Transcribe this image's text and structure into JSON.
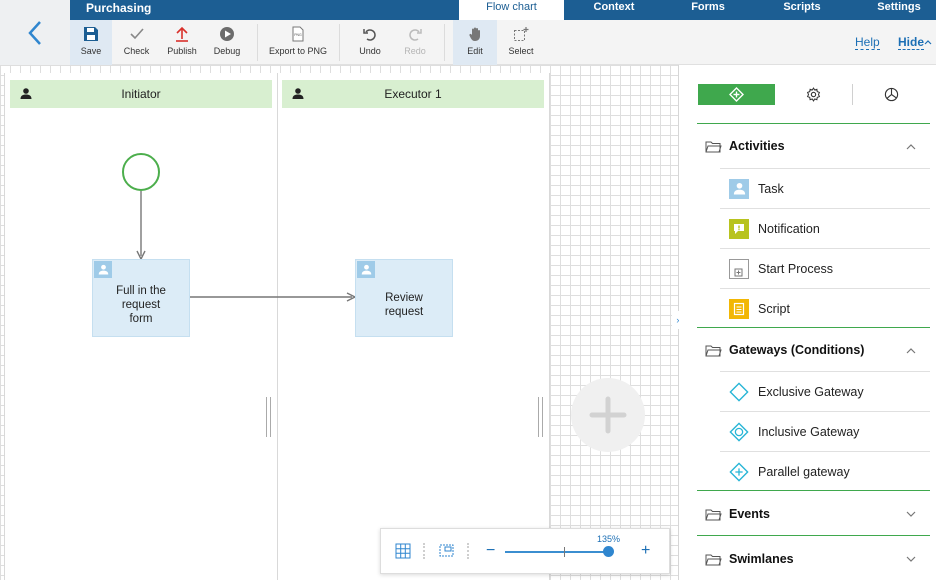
{
  "app": {
    "title": "Purchasing",
    "back_icon": "chevron-left-icon"
  },
  "nav_tabs": [
    {
      "label": "Flow chart",
      "active": true
    },
    {
      "label": "Context",
      "active": false
    },
    {
      "label": "Forms",
      "active": false
    },
    {
      "label": "Scripts",
      "active": false
    },
    {
      "label": "Settings",
      "active": false
    }
  ],
  "toolbar": {
    "save": "Save",
    "check": "Check",
    "publish": "Publish",
    "debug": "Debug",
    "export": "Export to PNG",
    "undo": "Undo",
    "redo": "Redo",
    "edit": "Edit",
    "select": "Select",
    "help": "Help",
    "hide": "Hide"
  },
  "lanes": [
    {
      "name": "Initiator"
    },
    {
      "name": "Executor 1"
    }
  ],
  "tasks": {
    "fill_form": [
      "Full in the",
      "request",
      "form"
    ],
    "review": [
      "Review",
      "request"
    ]
  },
  "zoom": {
    "percent_label": "135%",
    "value": 135
  },
  "panel": {
    "tabs": [
      {
        "icon": "diamond-icon",
        "active": true
      },
      {
        "icon": "gear-icon",
        "active": false
      },
      {
        "icon": "chart-icon",
        "active": false
      }
    ],
    "groups": {
      "activities": "Activities",
      "gateways": "Gateways (Conditions)",
      "events": "Events",
      "swimlanes": "Swimlanes"
    },
    "activities": {
      "task": "Task",
      "notification": "Notification",
      "start_process": "Start Process",
      "script": "Script"
    },
    "gateways": {
      "exclusive": "Exclusive Gateway",
      "inclusive": "Inclusive Gateway",
      "parallel": "Parallel gateway"
    }
  },
  "colors": {
    "nav_bg": "#1c5e93",
    "accent_green": "#3fa84d",
    "lane_header": "#d8efd0",
    "task_fill": "#dcecf7",
    "link_blue": "#1c6fb5",
    "gateway_cyan": "#26b5d6"
  }
}
